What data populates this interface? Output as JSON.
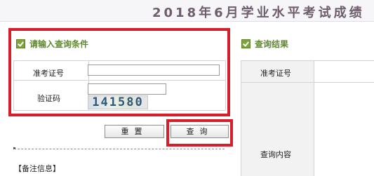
{
  "header": {
    "title": "2018年6月学业水平考试成绩"
  },
  "query_panel": {
    "heading": "请输入查询条件",
    "exam_id_label": "准考证号",
    "exam_id_value": "",
    "captcha_label": "验证码",
    "captcha_value": "",
    "captcha_image_text": "141580"
  },
  "buttons": {
    "reset_label": "重置",
    "query_label": "查询"
  },
  "notes": {
    "label": "【备注信息】"
  },
  "result_panel": {
    "heading": "查询结果",
    "exam_id_label": "准考证号",
    "content_label": "查询内容"
  },
  "colors": {
    "accent_red": "#d61f2b",
    "heading_green": "#5e8a2f",
    "title_purple": "#6d5d6d"
  }
}
